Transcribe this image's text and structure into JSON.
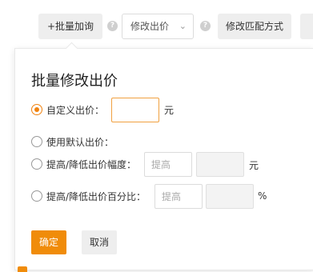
{
  "toolbar": {
    "batch_add_label": "+批量加询",
    "modify_price_select_value": "修改出价",
    "modify_match_label": "修改匹配方式",
    "help_glyph": "?"
  },
  "popover": {
    "title": "批量修改出价",
    "options": [
      {
        "label": "自定义出价：",
        "unit": "元",
        "checked": true
      },
      {
        "label": "使用默认出价：",
        "checked": false
      },
      {
        "label": "提高/降低出价幅度：",
        "select_placeholder": "提高",
        "unit": "元",
        "checked": false
      },
      {
        "label": "提高/降低出价百分比：",
        "select_placeholder": "提高",
        "unit": "%",
        "checked": false
      }
    ],
    "confirm_label": "确定",
    "cancel_label": "取消"
  },
  "colors": {
    "accent": "#f08c0a",
    "button_gray": "#eeeeee"
  }
}
